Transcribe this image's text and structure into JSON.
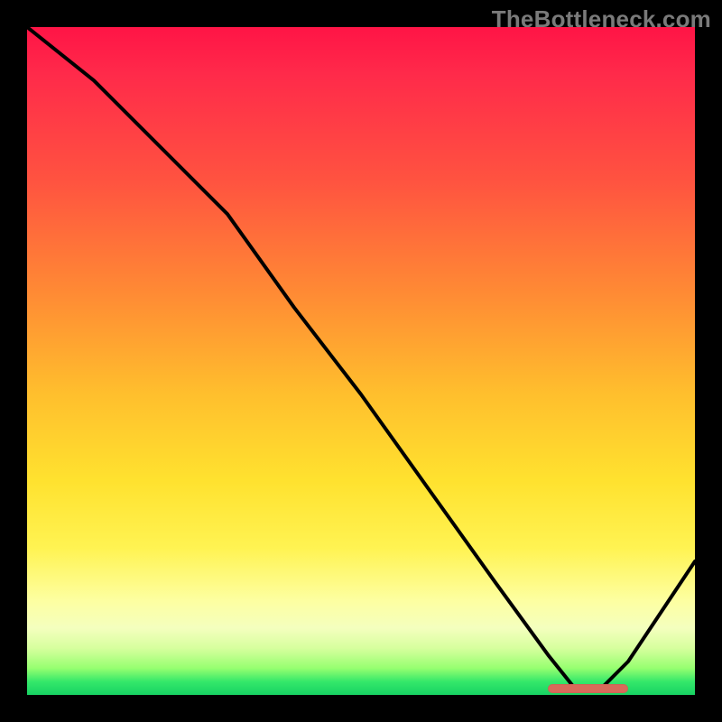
{
  "watermark": "TheBottleneck.com",
  "gradient_colors": {
    "top": "#ff1446",
    "mid_upper": "#ff8b34",
    "mid": "#ffe22f",
    "mid_lower": "#fdffa2",
    "bottom": "#17d263"
  },
  "chart_data": {
    "type": "line",
    "title": "",
    "xlabel": "",
    "ylabel": "",
    "xlim": [
      0,
      100
    ],
    "ylim": [
      0,
      100
    ],
    "grid": false,
    "series": [
      {
        "name": "bottleneck-curve",
        "x": [
          0,
          10,
          22,
          30,
          40,
          50,
          60,
          70,
          78,
          82,
          86,
          90,
          100
        ],
        "y": [
          100,
          92,
          80,
          72,
          58,
          45,
          31,
          17,
          6,
          1,
          1,
          5,
          20
        ]
      }
    ],
    "annotations": [
      {
        "name": "optimal-range-marker",
        "type": "pill",
        "x_start": 78,
        "x_end": 90,
        "y": 1,
        "color": "#d86a5a"
      }
    ]
  }
}
